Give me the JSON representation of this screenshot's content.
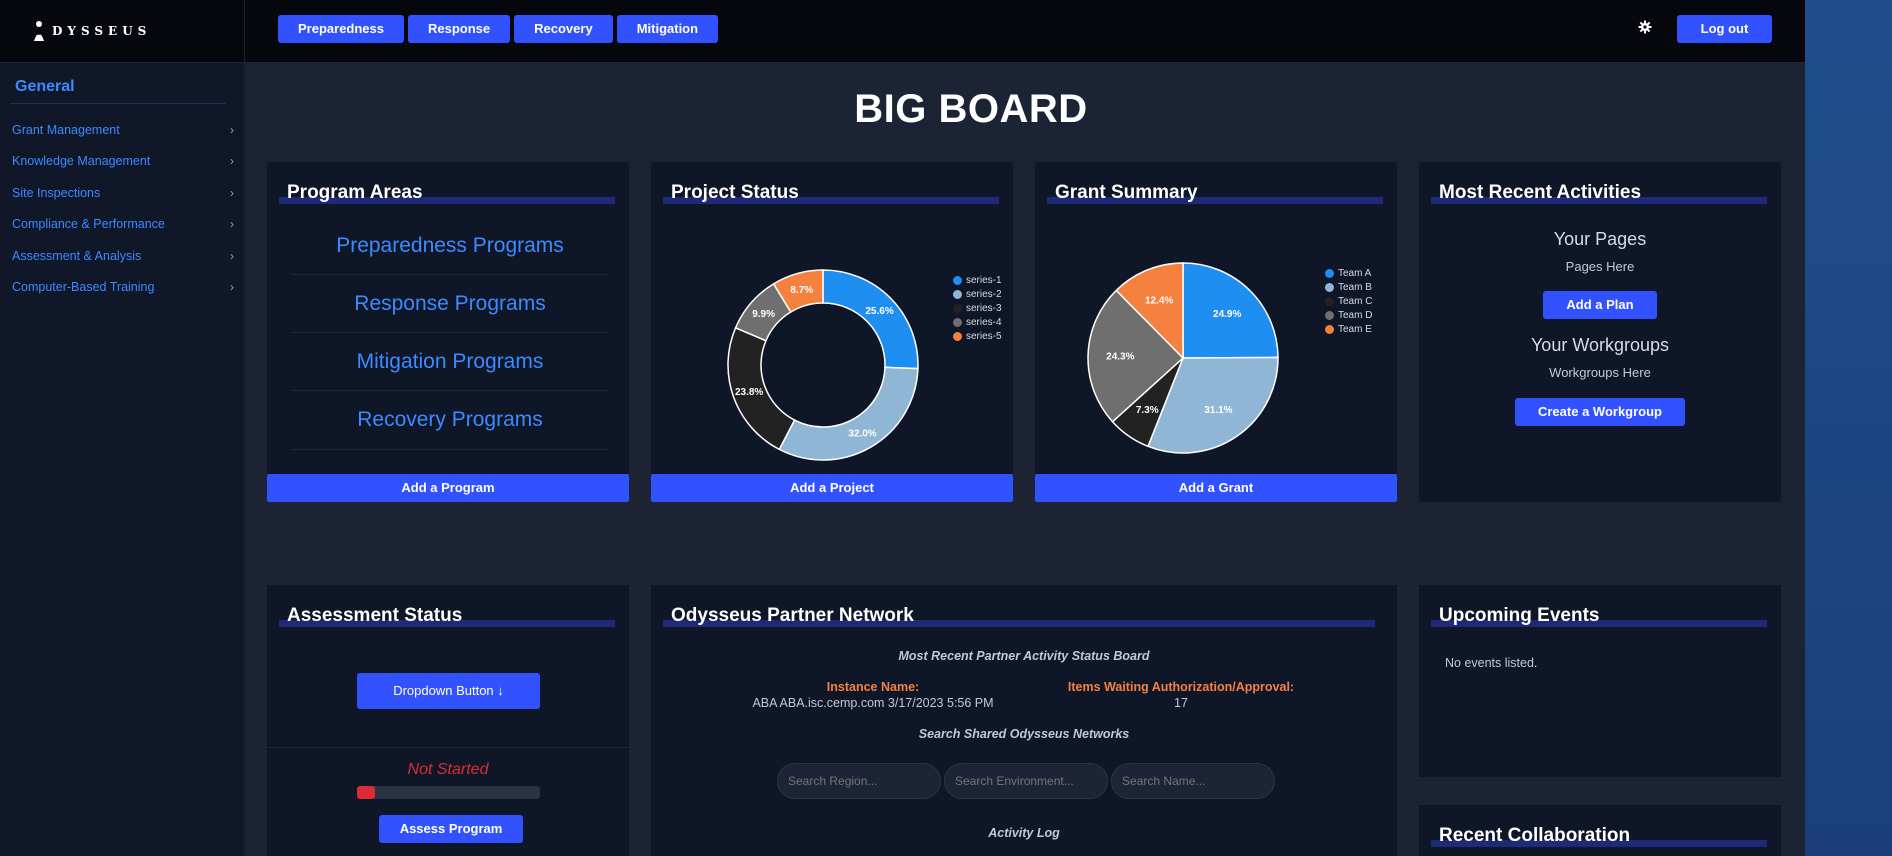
{
  "brand": {
    "logo_text": "DYSSEUS"
  },
  "topnav": [
    "Preparedness",
    "Response",
    "Recovery",
    "Mitigation"
  ],
  "header": {
    "logout_label": "Log out"
  },
  "sidebar": {
    "title": "General",
    "items": [
      {
        "label": "Grant Management"
      },
      {
        "label": "Knowledge Management"
      },
      {
        "label": "Site Inspections"
      },
      {
        "label": "Compliance & Performance"
      },
      {
        "label": "Assessment & Analysis"
      },
      {
        "label": "Computer-Based Training"
      }
    ]
  },
  "page": {
    "title": "BIG BOARD"
  },
  "program_areas": {
    "title": "Program Areas",
    "links": [
      "Preparedness Programs",
      "Response Programs",
      "Mitigation Programs",
      "Recovery Programs"
    ],
    "button": "Add a Program"
  },
  "project_status": {
    "title": "Project Status",
    "button": "Add a Project"
  },
  "grant_summary": {
    "title": "Grant Summary",
    "button": "Add a Grant"
  },
  "recent_activities": {
    "title": "Most Recent Activities",
    "pages_heading": "Your Pages",
    "pages_text": "Pages Here",
    "add_plan": "Add a Plan",
    "workgroups_heading": "Your Workgroups",
    "workgroups_text": "Workgroups Here",
    "create_workgroup": "Create a Workgroup"
  },
  "assessment": {
    "title": "Assessment Status",
    "dropdown_label": "Dropdown Button ↓",
    "status": "Not Started",
    "progress_fraction": 0.1,
    "assess_button": "Assess Program"
  },
  "network": {
    "title": "Odysseus Partner Network",
    "subtitle": "Most Recent Partner Activity Status Board",
    "instance_label": "Instance Name:",
    "instance_value": "ABA ABA.isc.cemp.com 3/17/2023 5:56 PM",
    "waiting_label": "Items Waiting Authorization/Approval:",
    "waiting_value": "17",
    "search_heading": "Search Shared Odysseus Networks",
    "search_region_placeholder": "Search Region...",
    "search_environment_placeholder": "Search Environment...",
    "search_name_placeholder": "Search Name...",
    "activity_log": "Activity Log"
  },
  "upcoming": {
    "title": "Upcoming Events",
    "empty_text": "No events listed."
  },
  "collab": {
    "title": "Recent Collaboration"
  },
  "colors": {
    "accent": "#3352ff",
    "link": "#3b8bff",
    "orange": "#f5813f",
    "red": "#dc2b35"
  },
  "chart_data": [
    {
      "type": "pie",
      "variant": "donut",
      "categories": [
        "series-1",
        "series-2",
        "series-3",
        "series-4",
        "series-5"
      ],
      "values": [
        25.6,
        32.0,
        23.8,
        9.9,
        8.7
      ],
      "labels": [
        "25.6%",
        "32.0%",
        "23.8%",
        "9.9%",
        "8.7%"
      ],
      "colors": [
        "#1f8ef1",
        "#90b6d6",
        "#222222",
        "#6f6f6f",
        "#f5813f"
      ],
      "legend": "right"
    },
    {
      "type": "pie",
      "categories": [
        "Team A",
        "Team B",
        "Team C",
        "Team D",
        "Team E"
      ],
      "values": [
        24.9,
        31.1,
        7.3,
        24.3,
        12.4
      ],
      "labels": [
        "24.9%",
        "31.1%",
        "7.3%",
        "24.3%",
        "12.4%"
      ],
      "colors": [
        "#1f8ef1",
        "#90b6d6",
        "#222222",
        "#6f6f6f",
        "#f5813f"
      ],
      "legend": "right"
    }
  ]
}
